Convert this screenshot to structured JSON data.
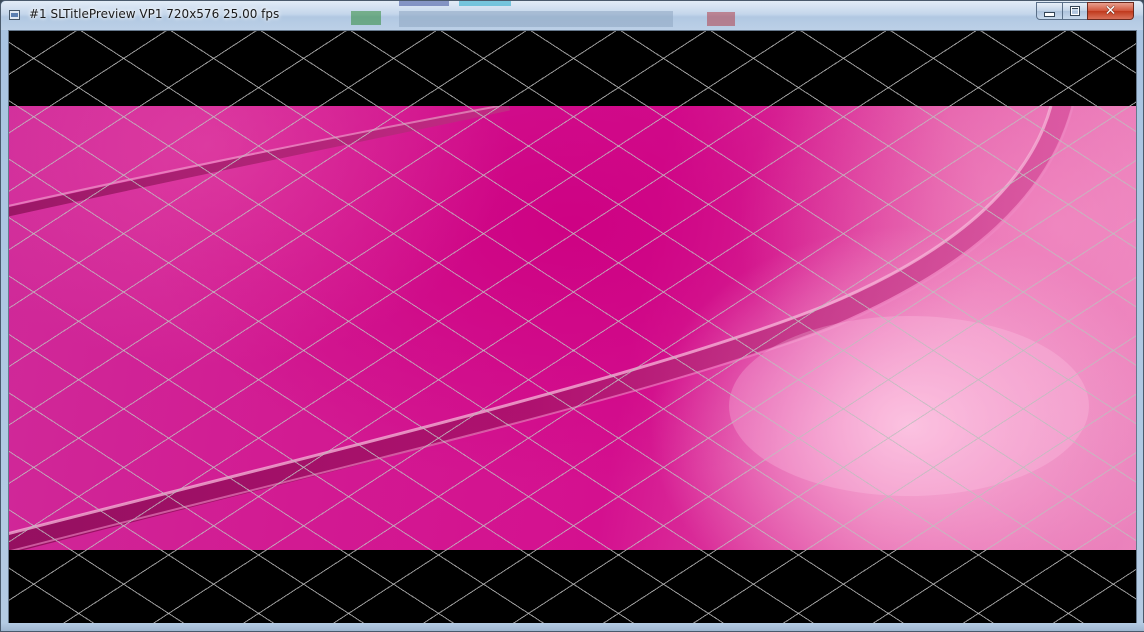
{
  "window": {
    "title": "#1 SLTitlePreview VP1 720x576 25.00 fps",
    "icon": "app-window-icon"
  },
  "controls": {
    "minimize_icon": "minimize-icon",
    "maximize_icon": "maximize-icon",
    "close_icon": "close-icon",
    "close_glyph": "✕"
  },
  "preview": {
    "letterbox_color": "#000000",
    "video_accent": "#d4108f",
    "overlay": "diamond-safe-area-grid"
  }
}
